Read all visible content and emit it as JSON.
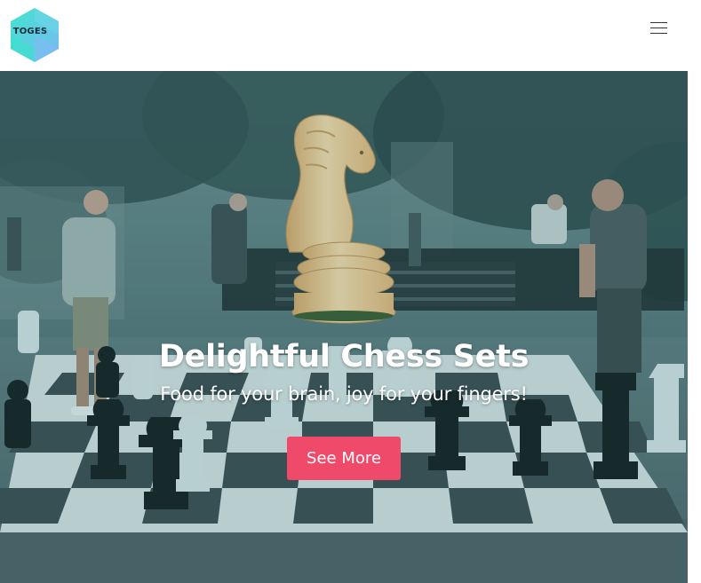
{
  "header": {
    "logo_text": "TOGES",
    "menu_icon": "hamburger-menu-icon"
  },
  "hero": {
    "title": "Delightful Chess Sets",
    "subtitle": "Food for your brain, joy for your fingers!",
    "cta_label": "See More",
    "image_icon": "chess-knight-image"
  },
  "colors": {
    "accent": "#f04a6a",
    "logo_teal": "#3ee6d6",
    "logo_blue": "#74c5f0",
    "hero_tint": "#4a6a6e",
    "knight": "#f5d29a"
  }
}
